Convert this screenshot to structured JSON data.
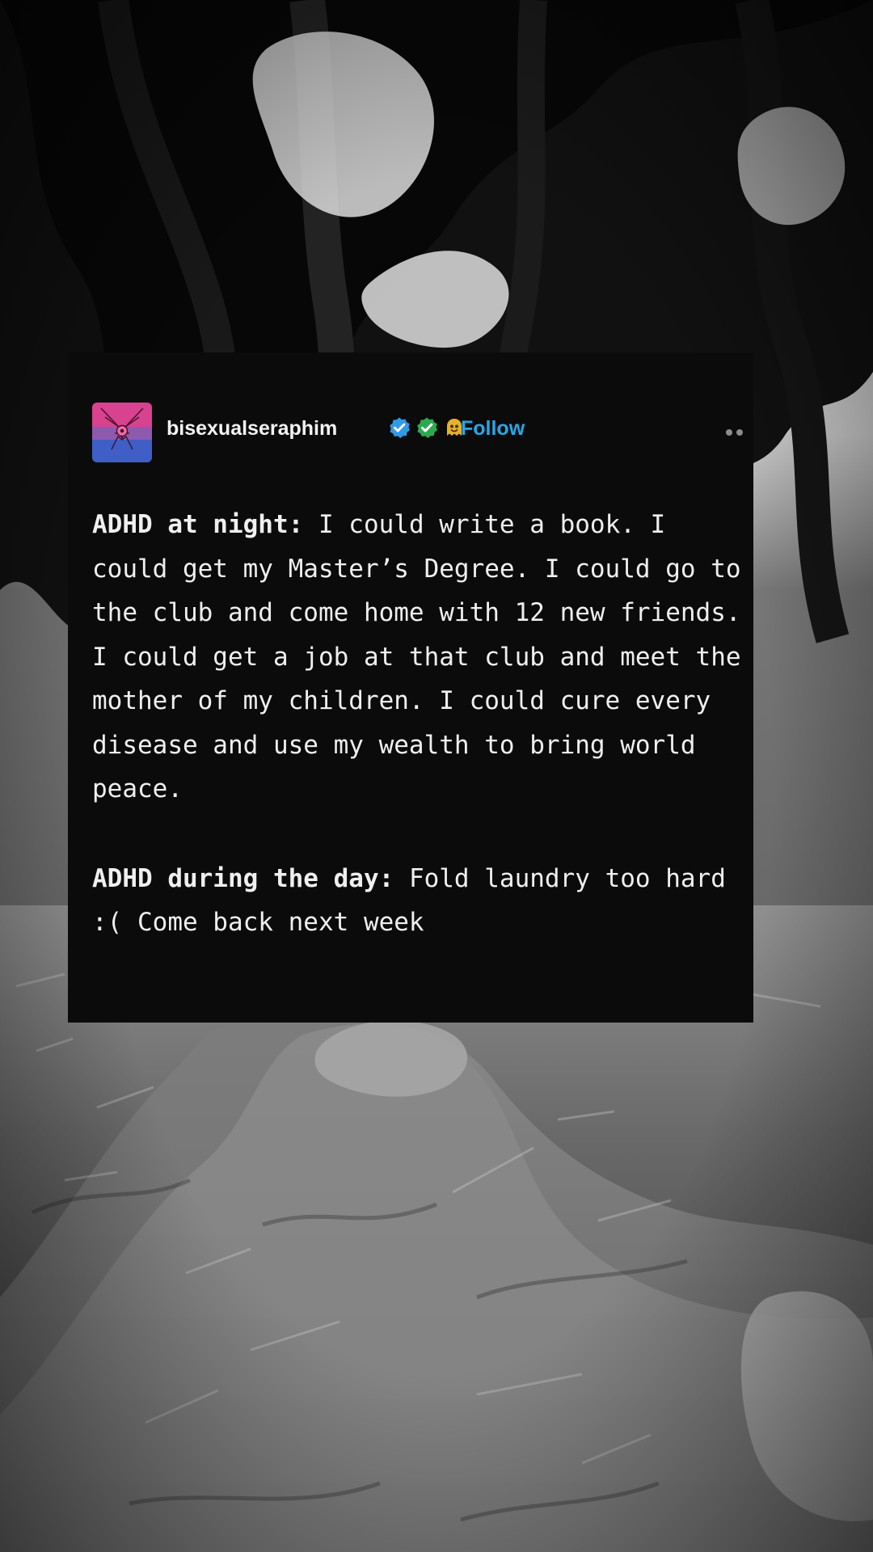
{
  "post": {
    "username": "bisexualseraphim",
    "follow_label": "Follow",
    "avatar_icon": "avatar-icon",
    "badges": [
      "blue-verified-badge-icon",
      "green-verified-badge-icon",
      "ghost-emoji-icon"
    ],
    "more_icon": "more-options-icon",
    "night_label": "ADHD at night:",
    "night_text": " I could write a book. I could get my Master’s Degree. I could go to the club and come home with 12 new friends. I could get a job at that club and meet the mother of my children. I could cure every disease and use my wealth to bring world peace.",
    "day_label": "ADHD during the day:",
    "day_text": " Fold laundry too hard :( Come back next week"
  },
  "colors": {
    "card_background": "#0b0b0b",
    "text": "#efefef",
    "follow": "#27a8e8",
    "blue_badge": "#2f9ae6",
    "green_badge": "#2ea84f"
  }
}
